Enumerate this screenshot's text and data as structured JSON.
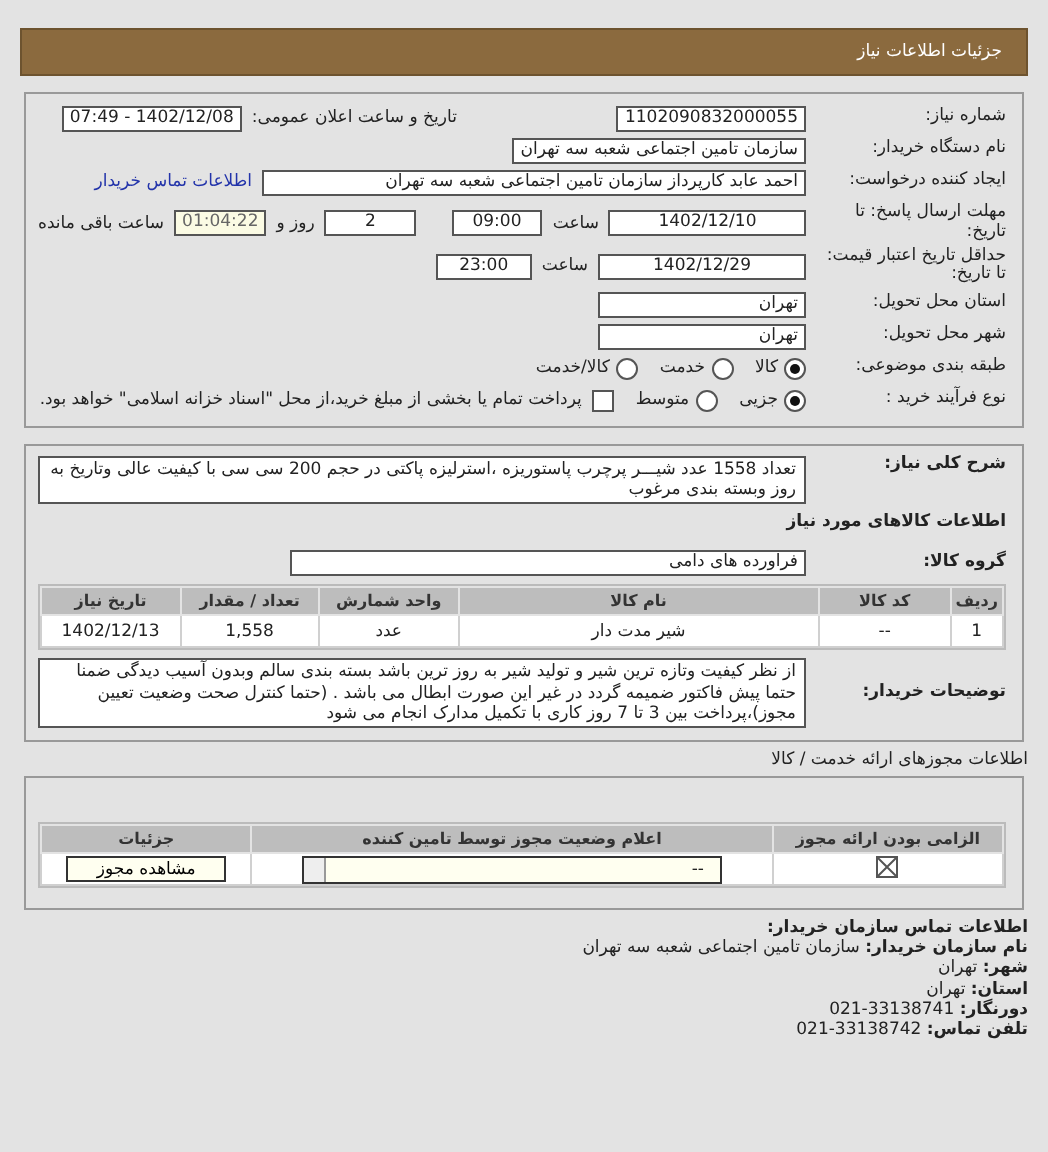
{
  "header": {
    "title": "جزئیات اطلاعات نیاز"
  },
  "need_number": {
    "label": "شماره نیاز:",
    "value": "1102090832000055"
  },
  "announce": {
    "label": "تاریخ و ساعت اعلان عمومی:",
    "value": "1402/12/08 - 07:49"
  },
  "buyer_org": {
    "label": "نام دستگاه خریدار:",
    "value": "سازمان تامین اجتماعی شعبه سه تهران"
  },
  "requester": {
    "label": "ایجاد کننده درخواست:",
    "value": "احمد عابد کارپرداز سازمان تامین اجتماعی شعبه سه تهران",
    "link": "اطلاعات تماس خریدار"
  },
  "deadline": {
    "label": "مهلت ارسال پاسخ: تا تاریخ:",
    "date": "1402/12/10",
    "time_label": "ساعت",
    "time": "09:00",
    "days": "2",
    "days_label": "روز و",
    "remaining": "01:04:22",
    "remaining_label": "ساعت باقی مانده"
  },
  "validity": {
    "label": "حداقل تاریخ اعتبار قیمت: تا تاریخ:",
    "date": "1402/12/29",
    "time_label": "ساعت",
    "time": "23:00"
  },
  "province": {
    "label": "استان محل تحویل:",
    "value": "تهران"
  },
  "city": {
    "label": "شهر محل تحویل:",
    "value": "تهران"
  },
  "category": {
    "label": "طبقه بندی موضوعی:",
    "options": [
      {
        "label": "کالا",
        "selected": true
      },
      {
        "label": "خدمت",
        "selected": false
      },
      {
        "label": "کالا/خدمت",
        "selected": false
      }
    ]
  },
  "process": {
    "label": "نوع فرآیند خرید :",
    "options": [
      {
        "label": "جزیی",
        "selected": true
      },
      {
        "label": "متوسط",
        "selected": false
      }
    ],
    "treasury": {
      "label": "پرداخت تمام یا بخشی از مبلغ خرید،از محل \"اسناد خزانه اسلامی\" خواهد بود.",
      "checked": false
    }
  },
  "description": {
    "label": "شرح کلی نیاز:",
    "value": "تعداد 1558 عدد شیـــر پرچرب پاستوریزه ،استرلیزه پاکتی در حجم 200 سی سی با کیفیت عالی وتاریخ به روز وبسته بندی مرغوب"
  },
  "goods_heading": "اطلاعات کالاهای مورد نیاز",
  "goods_group": {
    "label": "گروه کالا:",
    "value": "فراورده های دامی"
  },
  "items_table": {
    "columns": [
      "ردیف",
      "کد کالا",
      "نام کالا",
      "واحد شمارش",
      "تعداد / مقدار",
      "تاریخ نیاز"
    ],
    "rows": [
      [
        "1",
        "--",
        "شیر مدت دار",
        "عدد",
        "1,558",
        "1402/12/13"
      ]
    ]
  },
  "buyer_notes": {
    "label": "توضیحات خریدار:",
    "value": "از نظر کیفیت وتازه ترین شیر و تولید شیر به روز ترین باشد بسته بندی سالم وبدون آسیب دیدگی ضمنا حتما پیش فاکتور ضمیمه گردد در غیر این صورت ابطال می باشد . (حتما کنترل صحت وضعیت تعیین مجوز)،پرداخت بین 3 تا 7 روز کاری با تکمیل مدارک انجام می شود"
  },
  "licenses": {
    "title": "اطلاعات مجوزهای ارائه خدمت / کالا",
    "columns": [
      "الزامی بودن ارائه مجوز",
      "اعلام وضعیت مجوز توسط تامین کننده",
      "جزئیات"
    ],
    "rows": [
      {
        "required": true,
        "status": "--",
        "button": "مشاهده مجوز"
      }
    ]
  },
  "contact": {
    "heading": "اطلاعات تماس سازمان خریدار:",
    "lines": [
      {
        "label": "نام سازمان خریدار:",
        "value": "سازمان تامین اجتماعی شعبه سه تهران"
      },
      {
        "label": "شهر:",
        "value": "تهران"
      },
      {
        "label": "استان:",
        "value": "تهران"
      },
      {
        "label": "دورنگار:",
        "value": "021-33138741"
      },
      {
        "label": "تلفن تماس:",
        "value": "021-33138742"
      }
    ]
  }
}
